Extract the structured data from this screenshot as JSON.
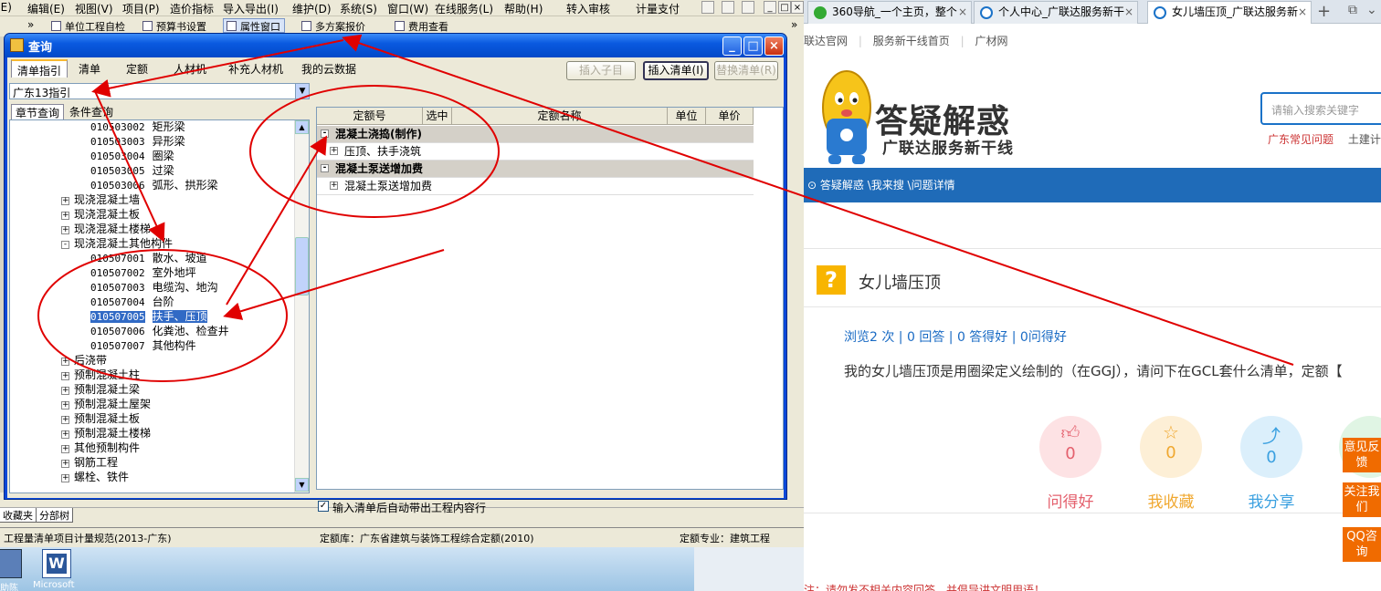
{
  "app": {
    "menu": [
      "(E)",
      "编辑(E)",
      "视图(V)",
      "项目(P)",
      "造价指标",
      "导入导出(I)",
      "维护(D)",
      "系统(S)",
      "窗口(W)",
      "在线服务(L)",
      "帮助(H)",
      "转入审核",
      "计量支付"
    ],
    "toolbar": [
      "单位工程自检",
      "预算书设置",
      "属性窗口",
      "多方案报价",
      "费用查看"
    ],
    "bottom_tabs": [
      "收藏夹",
      "分部树"
    ],
    "status": {
      "standard": "工程量清单项目计量规范(2013-广东)",
      "library": "定额库：广东省建筑与装饰工程综合定额(2010)",
      "major": "定额专业：建筑工程"
    },
    "desktop_icons": [
      {
        "label": "助陈"
      },
      {
        "label": "Microsoft"
      }
    ]
  },
  "dialog": {
    "title": "查询",
    "tabs": [
      "清单指引",
      "清单",
      "定额",
      "人材机",
      "补充人材机",
      "我的云数据"
    ],
    "buttons": {
      "insert_child": "插入子目",
      "insert_list": "插入清单(I)",
      "replace_list": "替换清单(R)"
    },
    "combo_value": "广东13指引",
    "subtabs": [
      "章节查询",
      "条件查询"
    ],
    "tree": [
      {
        "code": "010503002",
        "name": "矩形梁",
        "level": 2
      },
      {
        "code": "010503003",
        "name": "异形梁",
        "level": 2
      },
      {
        "code": "010503004",
        "name": "圈梁",
        "level": 2
      },
      {
        "code": "010503005",
        "name": "过梁",
        "level": 2
      },
      {
        "code": "010503006",
        "name": "弧形、拱形梁",
        "level": 2
      },
      {
        "code": "",
        "name": "现浇混凝土墙",
        "level": 1,
        "sign": "+"
      },
      {
        "code": "",
        "name": "现浇混凝土板",
        "level": 1,
        "sign": "+"
      },
      {
        "code": "",
        "name": "现浇混凝土楼梯",
        "level": 1,
        "sign": "+"
      },
      {
        "code": "",
        "name": "现浇混凝土其他构件",
        "level": 1,
        "sign": "-"
      },
      {
        "code": "010507001",
        "name": "散水、坡道",
        "level": 2
      },
      {
        "code": "010507002",
        "name": "室外地坪",
        "level": 2
      },
      {
        "code": "010507003",
        "name": "电缆沟、地沟",
        "level": 2
      },
      {
        "code": "010507004",
        "name": "台阶",
        "level": 2
      },
      {
        "code": "010507005",
        "name": "扶手、压顶",
        "level": 2,
        "selected": true
      },
      {
        "code": "010507006",
        "name": "化粪池、检查井",
        "level": 2
      },
      {
        "code": "010507007",
        "name": "其他构件",
        "level": 2
      },
      {
        "code": "",
        "name": "后浇带",
        "level": 1,
        "sign": "+"
      },
      {
        "code": "",
        "name": "预制混凝土柱",
        "level": 1,
        "sign": "+"
      },
      {
        "code": "",
        "name": "预制混凝土梁",
        "level": 1,
        "sign": "+"
      },
      {
        "code": "",
        "name": "预制混凝土屋架",
        "level": 1,
        "sign": "+"
      },
      {
        "code": "",
        "name": "预制混凝土板",
        "level": 1,
        "sign": "+"
      },
      {
        "code": "",
        "name": "预制混凝土楼梯",
        "level": 1,
        "sign": "+"
      },
      {
        "code": "",
        "name": "其他预制构件",
        "level": 1,
        "sign": "+"
      },
      {
        "code": "",
        "name": "钢筋工程",
        "level": 1,
        "sign": "+"
      },
      {
        "code": "",
        "name": "螺栓、铁件",
        "level": 1,
        "sign": "+"
      }
    ],
    "grid": {
      "headers": [
        "定额号",
        "选中",
        "定额名称",
        "单位",
        "单价"
      ],
      "rows": [
        {
          "text": "混凝土浇捣(制作)",
          "group": true,
          "sign": "-"
        },
        {
          "text": "压顶、扶手浇筑",
          "group": false,
          "sign": "+"
        },
        {
          "text": "混凝土泵送增加费",
          "group": true,
          "sign": "-"
        },
        {
          "text": "混凝土泵送增加费",
          "group": false,
          "sign": "+"
        }
      ]
    },
    "checkbox_label": "输入清单后自动带出工程内容行"
  },
  "browser": {
    "tabs": [
      {
        "title": "360导航_一个主页，整个"
      },
      {
        "title": "个人中心_广联达服务新干"
      },
      {
        "title": "女儿墙压顶_广联达服务新"
      }
    ],
    "top_nav": [
      "联达官网",
      "服务新干线首页",
      "广材网"
    ],
    "logo_title": "答疑解惑",
    "logo_sub": "广联达服务新干线",
    "search_placeholder": "请输入搜索关键字",
    "hot_links": [
      "广东常见问题",
      "土建计"
    ],
    "breadcrumb": "答疑解惑 \\我来搜 \\问题详情",
    "question_title": "女儿墙压顶",
    "stats": "浏览2 次 | 0 回答 | 0 答得好 | 0问得好",
    "question_body": "我的女儿墙压顶是用圈梁定义绘制的（在GGJ），请问下在GCL套什么清单，定额【",
    "actions": [
      {
        "label": "问得好",
        "count": "0"
      },
      {
        "label": "我收藏",
        "count": "0"
      },
      {
        "label": "我分享",
        "count": "0"
      }
    ],
    "side_buttons": [
      "意见反馈",
      "关注我们",
      "QQ咨询"
    ],
    "footer_text": "注：请勿发不相关内容回答，并倡导讲文明用语！"
  },
  "colors": {
    "dialog_blue": "#0a48d8",
    "browser_blue": "#1f6bb8",
    "annotation_red": "#e00000",
    "side_orange": "#f06b00"
  }
}
